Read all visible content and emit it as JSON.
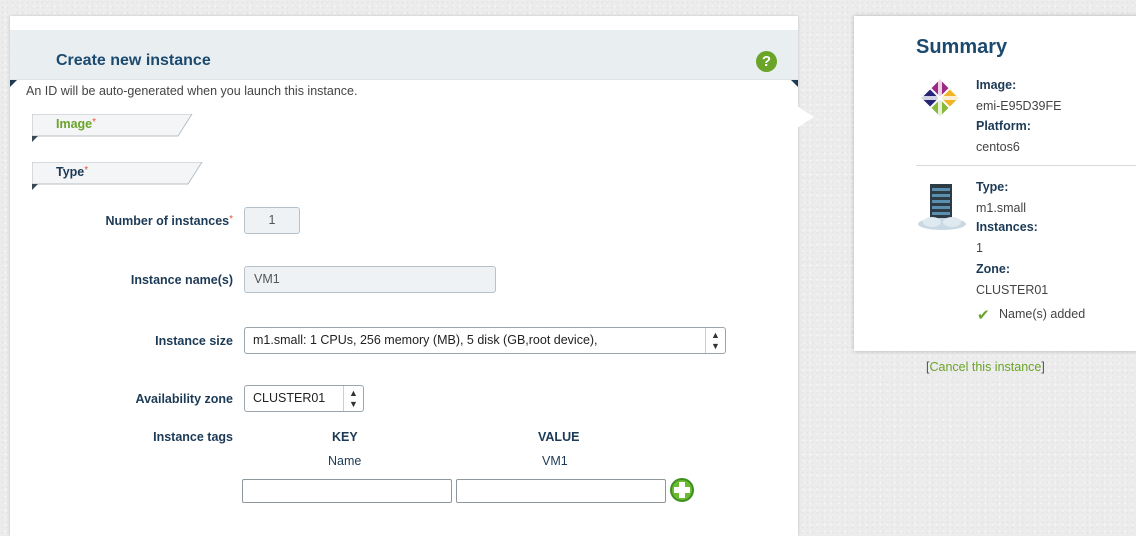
{
  "panel": {
    "title": "Create new instance",
    "help_icon": "?",
    "intro": "An ID will be auto-generated when you launch this instance."
  },
  "sections": {
    "image": {
      "label": "Image",
      "required": "*"
    },
    "type": {
      "label": "Type",
      "required": "*"
    }
  },
  "form": {
    "num_instances": {
      "label": "Number of instances",
      "required": "*",
      "value": "1"
    },
    "instance_names": {
      "label": "Instance name(s)",
      "value": "VM1"
    },
    "instance_size": {
      "label": "Instance size",
      "value": "m1.small: 1 CPUs, 256 memory (MB), 5 disk (GB,root device),"
    },
    "availability_zone": {
      "label": "Availability zone",
      "value": "CLUSTER01"
    },
    "instance_tags": {
      "label": "Instance tags",
      "key_header": "KEY",
      "value_header": "VALUE",
      "rows": [
        {
          "key": "Name",
          "value": "VM1"
        }
      ],
      "key_placeholder": "",
      "value_placeholder": ""
    }
  },
  "summary": {
    "title": "Summary",
    "image_label": "Image:",
    "image_value": "emi-E95D39FE",
    "platform_label": "Platform:",
    "platform_value": "centos6",
    "type_label": "Type:",
    "type_value": "m1.small",
    "instances_label": "Instances:",
    "instances_value": "1",
    "zone_label": "Zone:",
    "zone_value": "CLUSTER01",
    "names_status": "Name(s) added"
  },
  "cancel": {
    "open": "[",
    "link": "Cancel this instance",
    "close": "]"
  },
  "colors": {
    "accent_green": "#6aa428",
    "title_blue": "#1c4a6e",
    "required_orange": "#e05a3a"
  },
  "icons": {
    "help": "help-icon",
    "centos_logo": "centos-logo-icon",
    "server": "server-cloud-icon",
    "check": "checkmark-icon",
    "add": "add-tag-icon"
  }
}
